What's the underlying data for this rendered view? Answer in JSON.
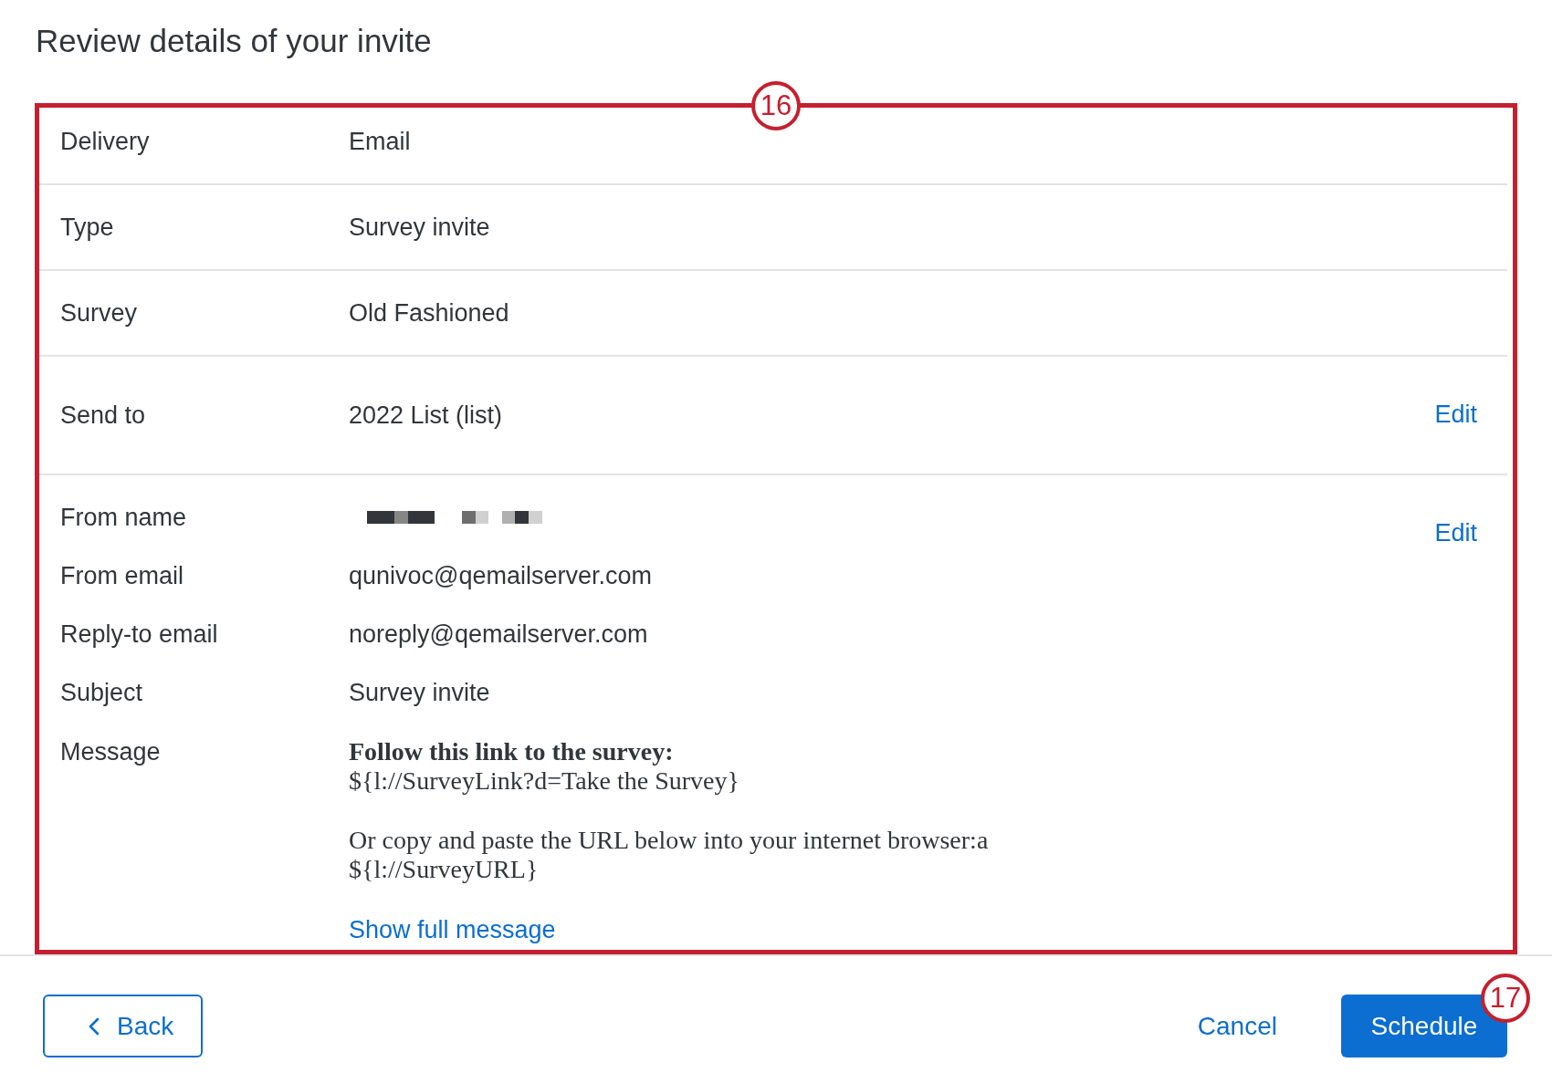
{
  "page_title": "Review details of your invite",
  "details": {
    "callout": "16",
    "sections": [
      {
        "rows": [
          {
            "kind": "text",
            "label": "Delivery",
            "value": "Email"
          }
        ]
      },
      {
        "rows": [
          {
            "kind": "text",
            "label": "Type",
            "value": "Survey invite"
          }
        ]
      },
      {
        "rows": [
          {
            "kind": "text",
            "label": "Survey",
            "value": "Old Fashioned"
          }
        ]
      },
      {
        "rows": [
          {
            "kind": "text",
            "label": "Send to",
            "value": "2022 List (list)"
          }
        ],
        "action": "Edit"
      },
      {
        "rows": [
          {
            "kind": "redacted",
            "label": "From name"
          },
          {
            "kind": "text",
            "label": "From email",
            "value": "qunivoc@qemailserver.com"
          },
          {
            "kind": "text",
            "label": "Reply-to email",
            "value": "noreply@qemailserver.com"
          },
          {
            "kind": "text",
            "label": "Subject",
            "value": "Survey invite"
          },
          {
            "kind": "message",
            "label": "Message",
            "paragraphs": [
              "**Follow this link to the survey:**\n${l://SurveyLink?d=Take the Survey}",
              "Or copy and paste the URL below into your internet browser:a\n${l://SurveyURL}"
            ],
            "link": "Show full message"
          }
        ],
        "action": "Edit"
      }
    ]
  },
  "footer": {
    "buttons": [
      {
        "kind": "back",
        "label": "Back"
      },
      {
        "kind": "cancel",
        "label": "Cancel"
      },
      {
        "kind": "primary",
        "label": "Schedule",
        "callout": "17"
      }
    ]
  }
}
